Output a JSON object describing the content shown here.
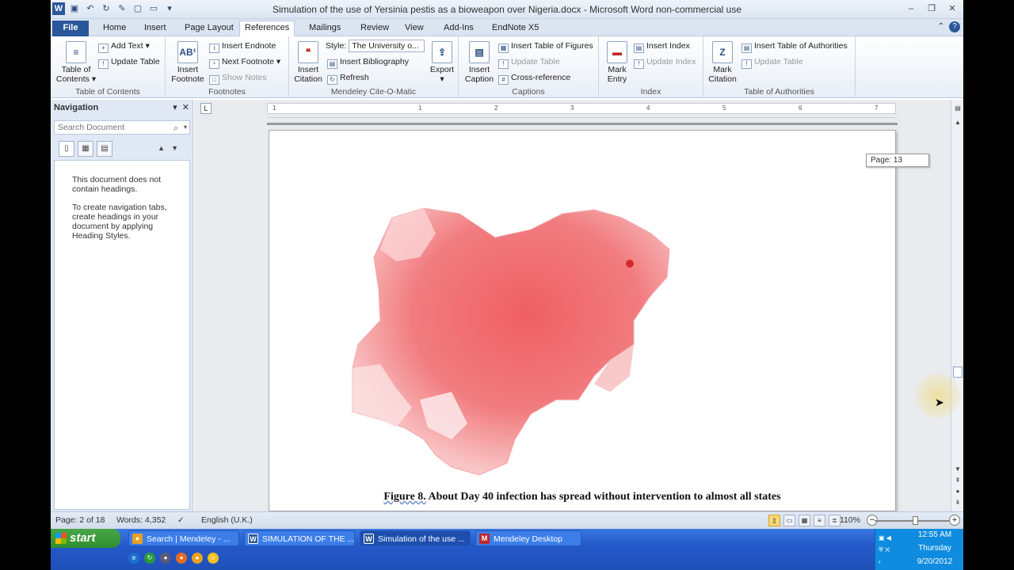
{
  "window": {
    "title": "Simulation of the use of Yersinia pestis as a bioweapon over Nigeria.docx - Microsoft Word non-commercial use"
  },
  "tabs": [
    "File",
    "Home",
    "Insert",
    "Page Layout",
    "References",
    "Mailings",
    "Review",
    "View",
    "Add-Ins",
    "EndNote X5"
  ],
  "active_tab": "References",
  "ribbon": {
    "toc": {
      "big": "Table of Contents",
      "add_text": "Add Text",
      "update_table": "Update Table",
      "label": "Table of Contents"
    },
    "footnotes": {
      "big": "Insert Footnote",
      "insert_endnote": "Insert Endnote",
      "next_footnote": "Next Footnote",
      "show_notes": "Show Notes",
      "label": "Footnotes"
    },
    "mendeley": {
      "insert_citation": "Insert Citation",
      "style_label": "Style:",
      "style_value": "The University o...",
      "insert_bibliography": "Insert Bibliography",
      "refresh": "Refresh",
      "export": "Export",
      "label": "Mendeley Cite-O-Matic"
    },
    "captions": {
      "insert_caption": "Insert Caption",
      "insert_tof": "Insert Table of Figures",
      "update_table": "Update Table",
      "cross_reference": "Cross-reference",
      "label": "Captions"
    },
    "index": {
      "mark_entry": "Mark Entry",
      "insert_index": "Insert Index",
      "update_index": "Update Index",
      "label": "Index"
    },
    "toa": {
      "mark_citation": "Mark Citation",
      "insert_toa": "Insert Table of Authorities",
      "update_table": "Update Table",
      "label": "Table of Authorities"
    }
  },
  "navigation": {
    "title": "Navigation",
    "search_placeholder": "Search Document",
    "message1": "This document does not contain headings.",
    "message2": "To create navigation tabs, create headings in your document by applying Heading Styles."
  },
  "document": {
    "page_tooltip": "Page: 13",
    "caption_fig": "Figure 8.",
    "caption_text": " About Day 40 infection has spread without intervention to almost all states",
    "ruler_numbers": [
      "1",
      "1",
      "2",
      "3",
      "4",
      "5",
      "6",
      "7"
    ]
  },
  "status": {
    "page": "Page: 2 of 18",
    "words": "Words: 4,352",
    "language": "English (U.K.)",
    "zoom": "110%"
  },
  "taskbar": {
    "start": "start",
    "tasks": [
      {
        "label": "Search | Mendeley - ...",
        "icon": "chrome-icon",
        "color": "#e8a020"
      },
      {
        "label": "SIMULATION OF THE ...",
        "icon": "word-icon",
        "color": "#2a579a"
      },
      {
        "label": "Simulation of the use ...",
        "icon": "word-icon",
        "color": "#2a579a"
      },
      {
        "label": "Mendeley Desktop",
        "icon": "mendeley-icon",
        "color": "#c0262c"
      }
    ],
    "clock_time": "12:55 AM",
    "clock_day": "Thursday",
    "clock_date": "9/20/2012"
  },
  "colors": {
    "accent": "#2a579a",
    "map_fill": "#ef6f72",
    "taskbar": "#2459c9"
  }
}
